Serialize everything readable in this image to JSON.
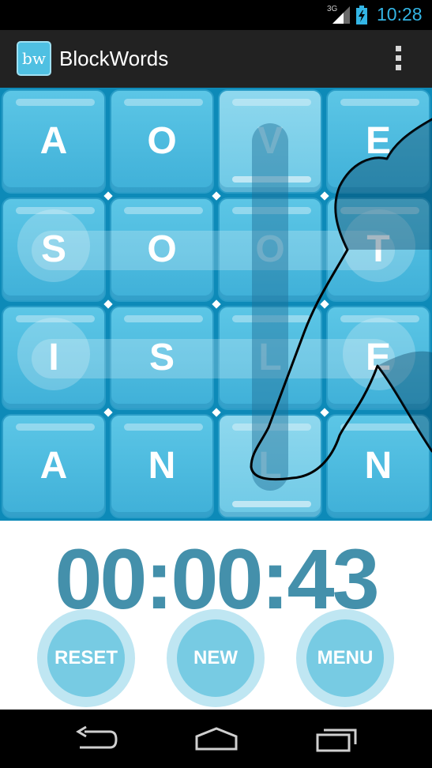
{
  "status_bar": {
    "network": "3G",
    "time": "10:28"
  },
  "app_bar": {
    "icon_text": "bw",
    "title": "BlockWords",
    "overflow_icon": "overflow-menu-icon"
  },
  "board": {
    "rows": [
      [
        "A",
        "O",
        "V",
        "E"
      ],
      [
        "S",
        "O",
        "O",
        "T"
      ],
      [
        "I",
        "S",
        "L",
        "E"
      ],
      [
        "A",
        "N",
        "L",
        "N"
      ]
    ],
    "selected_tiles": [
      [
        0,
        2
      ],
      [
        3,
        2
      ]
    ]
  },
  "timer": "00:00:43",
  "buttons": {
    "reset": "RESET",
    "new": "NEW",
    "menu": "MENU"
  },
  "nav": {
    "back": "back-icon",
    "home": "home-icon",
    "recents": "recent-apps-icon"
  },
  "colors": {
    "board_bg": "#0d8ab8",
    "tile": "#4fbce2",
    "timer": "#4490ab",
    "button": "#77cbe3",
    "accent": "#33b5e5"
  }
}
